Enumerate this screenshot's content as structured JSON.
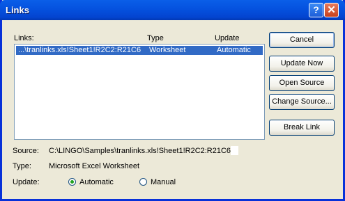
{
  "window": {
    "title": "Links",
    "help_glyph": "?",
    "close_glyph": "✕"
  },
  "list": {
    "label": "Links:",
    "col_type": "Type",
    "col_update": "Update",
    "rows": [
      {
        "link": "...\\tranlinks.xls!Sheet1!R2C2:R21C6",
        "type": "Worksheet",
        "update": "Automatic",
        "selected": true
      }
    ]
  },
  "buttons": {
    "cancel": "Cancel",
    "update_now": "Update Now",
    "open_source": "Open Source",
    "change_source": "Change Source...",
    "break_link": "Break Link"
  },
  "details": {
    "source_label": "Source:",
    "source_value": "C:\\LINGO\\Samples\\tranlinks.xls!Sheet1!R2C2:R21C6",
    "type_label": "Type:",
    "type_value": "Microsoft Excel Worksheet",
    "update_label": "Update:",
    "options": [
      {
        "label": "Automatic",
        "checked": true
      },
      {
        "label": "Manual",
        "checked": false
      }
    ]
  },
  "colors": {
    "selection": "#316ac5",
    "titlebar": "#0553e0",
    "window_bg": "#ece9d8"
  }
}
